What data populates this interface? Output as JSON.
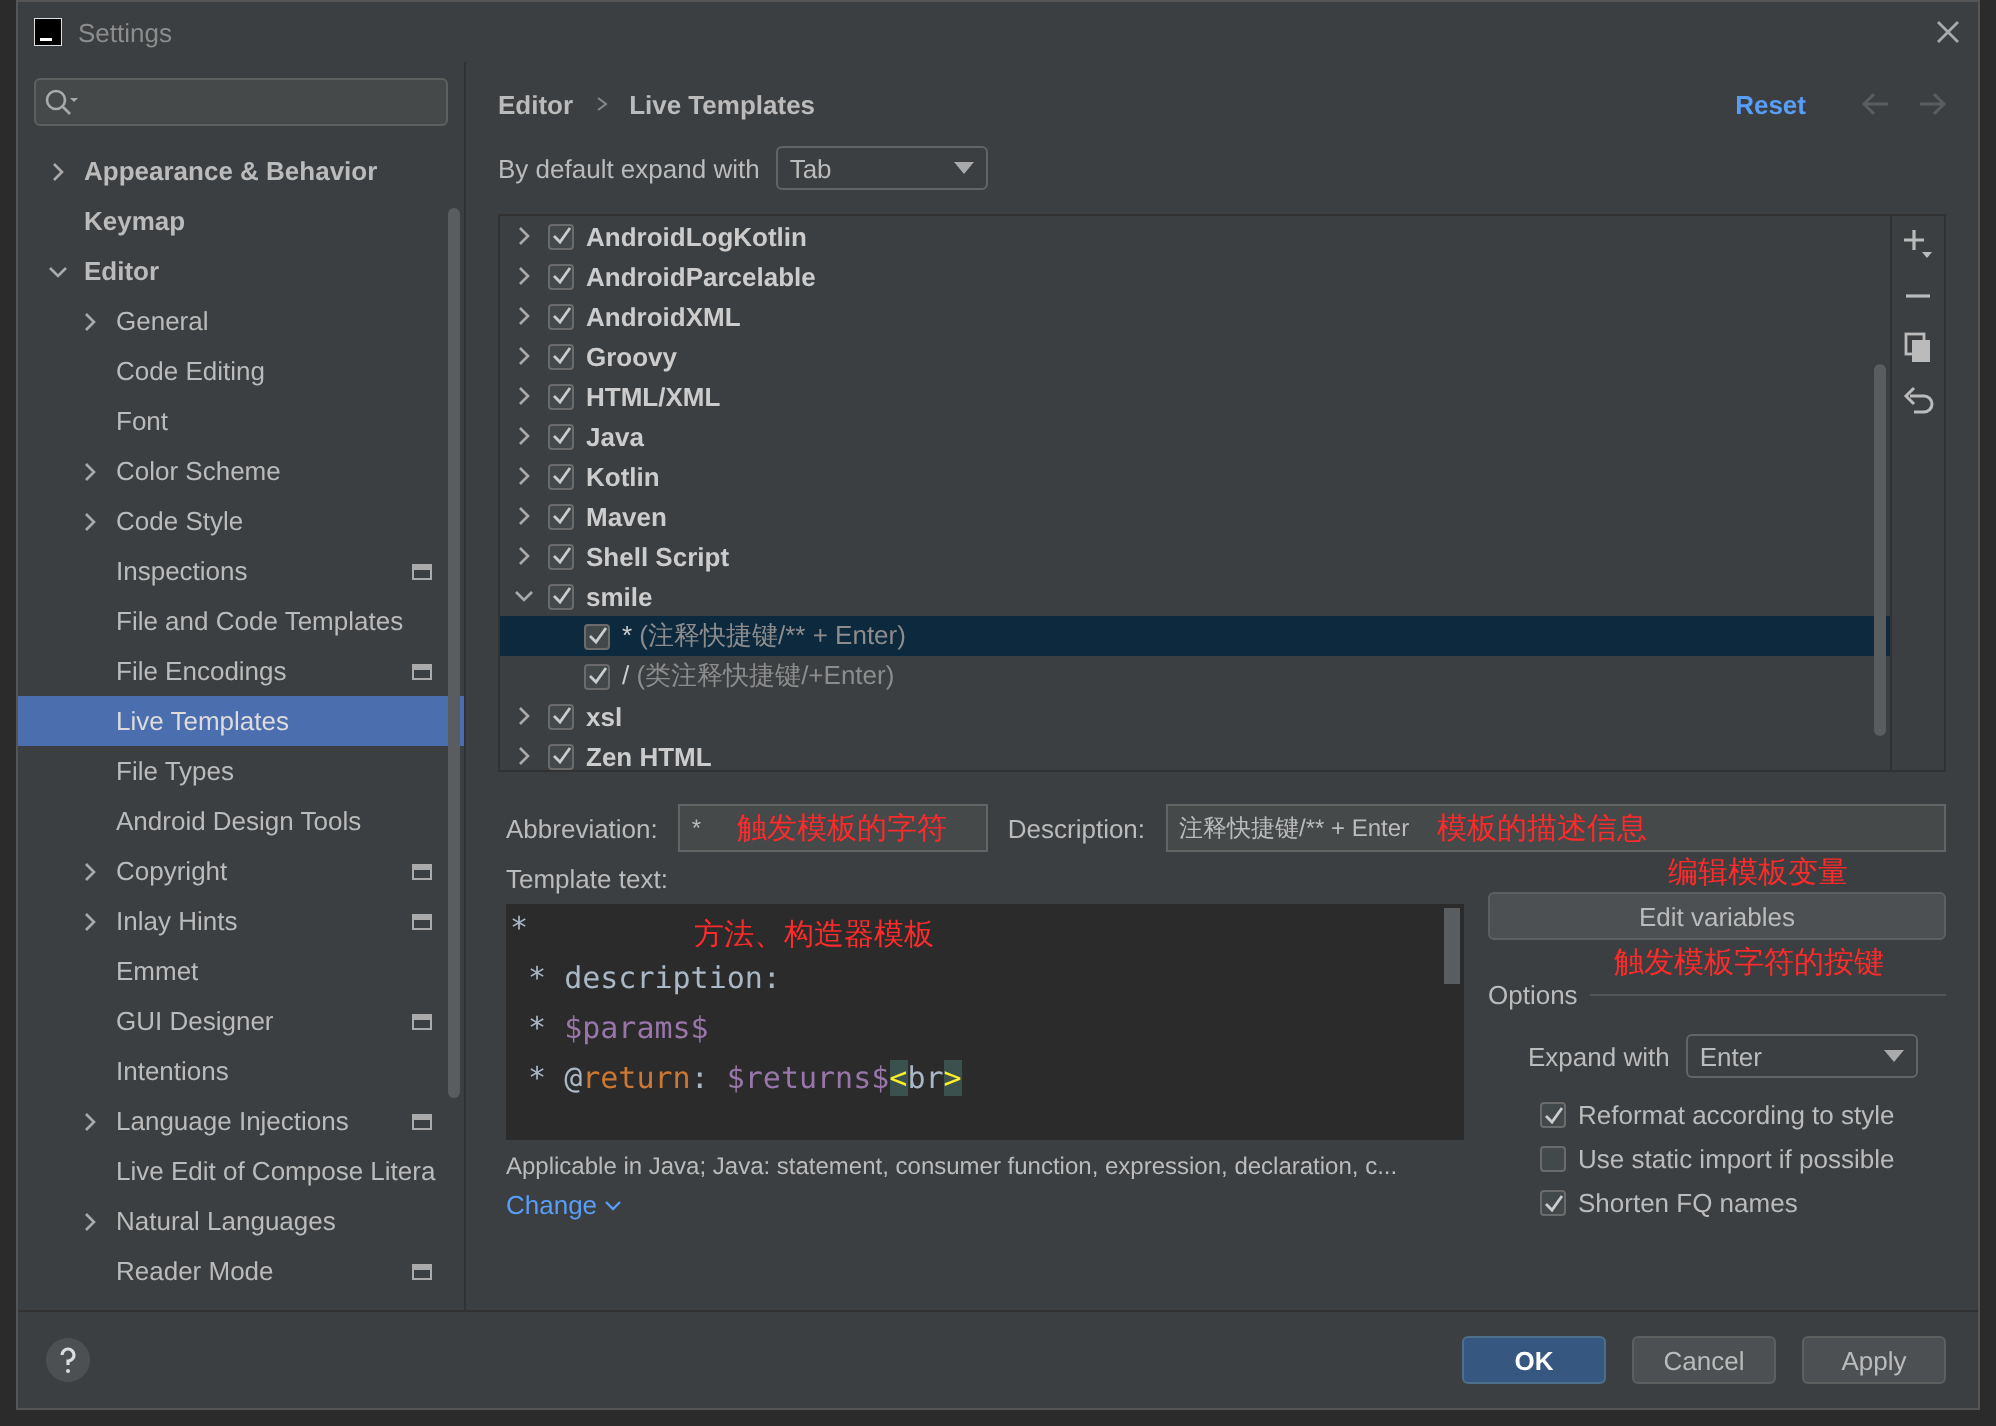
{
  "window": {
    "title": "Settings"
  },
  "sidebar": {
    "items": [
      {
        "label": "Appearance & Behavior",
        "expanded": false,
        "selected": false
      },
      {
        "label": "Keymap",
        "selected": false
      },
      {
        "label": "Editor",
        "expanded": true,
        "selected": false,
        "children": [
          {
            "label": "General",
            "expanded": false,
            "selected": false
          },
          {
            "label": "Code Editing",
            "selected": false
          },
          {
            "label": "Font",
            "selected": false
          },
          {
            "label": "Color Scheme",
            "expanded": false,
            "selected": false
          },
          {
            "label": "Code Style",
            "expanded": false,
            "selected": false
          },
          {
            "label": "Inspections",
            "project_level": true,
            "selected": false
          },
          {
            "label": "File and Code Templates",
            "selected": false
          },
          {
            "label": "File Encodings",
            "project_level": true,
            "selected": false
          },
          {
            "label": "Live Templates",
            "selected": true
          },
          {
            "label": "File Types",
            "selected": false
          },
          {
            "label": "Android Design Tools",
            "selected": false
          },
          {
            "label": "Copyright",
            "expanded": false,
            "project_level": true,
            "selected": false
          },
          {
            "label": "Inlay Hints",
            "expanded": false,
            "project_level": true,
            "selected": false
          },
          {
            "label": "Emmet",
            "selected": false
          },
          {
            "label": "GUI Designer",
            "project_level": true,
            "selected": false
          },
          {
            "label": "Intentions",
            "selected": false
          },
          {
            "label": "Language Injections",
            "expanded": false,
            "project_level": true,
            "selected": false
          },
          {
            "label": "Live Edit of Compose Litera",
            "selected": false
          },
          {
            "label": "Natural Languages",
            "expanded": false,
            "selected": false
          },
          {
            "label": "Reader Mode",
            "project_level": true,
            "selected": false
          }
        ]
      }
    ]
  },
  "breadcrumb": [
    "Editor",
    "Live Templates"
  ],
  "reset": "Reset",
  "default_expand": {
    "label": "By default expand with",
    "value": "Tab"
  },
  "templates": [
    {
      "label": "AndroidLogKotlin",
      "checked": true,
      "expanded": false,
      "selected": false
    },
    {
      "label": "AndroidParcelable",
      "checked": true,
      "expanded": false,
      "selected": false
    },
    {
      "label": "AndroidXML",
      "checked": true,
      "expanded": false,
      "selected": false
    },
    {
      "label": "Groovy",
      "checked": true,
      "expanded": false,
      "selected": false
    },
    {
      "label": "HTML/XML",
      "checked": true,
      "expanded": false,
      "selected": false
    },
    {
      "label": "Java",
      "checked": true,
      "expanded": false,
      "selected": false
    },
    {
      "label": "Kotlin",
      "checked": true,
      "expanded": false,
      "selected": false
    },
    {
      "label": "Maven",
      "checked": true,
      "expanded": false,
      "selected": false
    },
    {
      "label": "Shell Script",
      "checked": true,
      "expanded": false,
      "selected": false
    },
    {
      "label": "smile",
      "checked": true,
      "expanded": true,
      "selected": false,
      "children": [
        {
          "abbreviation": "*",
          "description": "(注释快捷键/** + Enter)",
          "checked": true,
          "selected": true
        },
        {
          "abbreviation": "/",
          "description": "(类注释快捷键/+Enter)",
          "checked": true,
          "selected": false
        }
      ]
    },
    {
      "label": "xsl",
      "checked": true,
      "expanded": false,
      "selected": false
    },
    {
      "label": "Zen HTML",
      "checked": true,
      "expanded": false,
      "selected": false
    }
  ],
  "abbreviation": {
    "label": "Abbreviation:",
    "value": "*",
    "note": "触发模板的字符"
  },
  "description": {
    "label": "Description:",
    "value": "注释快捷键/** + Enter",
    "note": "模板的描述信息"
  },
  "template_text": {
    "label": "Template text:",
    "note": "方法、构造器模板",
    "lines": [
      [
        {
          "text": "*",
          "kind": "plain"
        }
      ],
      [
        {
          "text": " * description:",
          "kind": "plain"
        }
      ],
      [
        {
          "text": " * ",
          "kind": "plain"
        },
        {
          "text": "$params$",
          "kind": "var"
        }
      ],
      [
        {
          "text": " * @",
          "kind": "plain"
        },
        {
          "text": "return",
          "kind": "keyword"
        },
        {
          "text": ": ",
          "kind": "plain"
        },
        {
          "text": "$returns$",
          "kind": "var"
        },
        {
          "text": "<",
          "kind": "bracket"
        },
        {
          "text": "br",
          "kind": "plain"
        },
        {
          "text": ">",
          "kind": "bracket"
        }
      ]
    ]
  },
  "edit_variables": {
    "label": "Edit variables",
    "note": "编辑模板变量"
  },
  "options": {
    "title": "Options",
    "note": "触发模板字符的按键",
    "expand_with": {
      "label": "Expand with",
      "value": "Enter"
    },
    "checks": [
      {
        "label": "Reformat according to style",
        "checked": true
      },
      {
        "label": "Use static import if possible",
        "checked": false
      },
      {
        "label": "Shorten FQ names",
        "checked": true
      }
    ]
  },
  "applicable": "Applicable in Java; Java: statement, consumer function, expression, declaration, c...",
  "change": "Change",
  "buttons": [
    {
      "label": "OK",
      "kind": "primary"
    },
    {
      "label": "Cancel",
      "kind": "normal"
    },
    {
      "label": "Apply",
      "kind": "normal"
    }
  ]
}
